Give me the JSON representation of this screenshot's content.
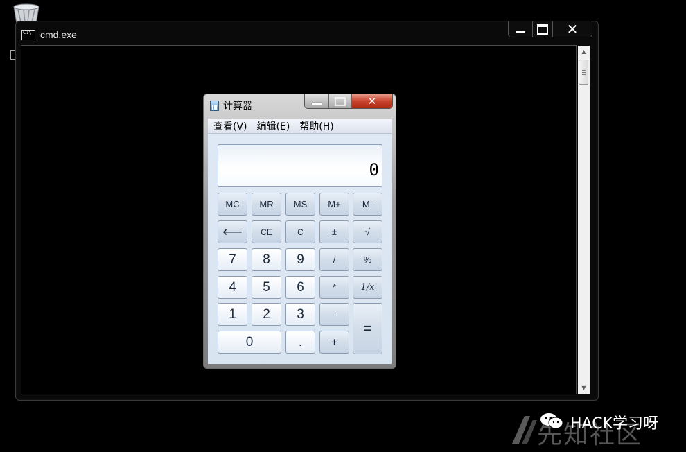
{
  "cmd": {
    "title": "cmd.exe",
    "icon": "console-icon",
    "controls": {
      "minimize": "minimize-icon",
      "maximize": "maximize-icon",
      "close": "close-icon"
    }
  },
  "calculator": {
    "title": "计算器",
    "menu": [
      "查看(V)",
      "编辑(E)",
      "帮助(H)"
    ],
    "display_value": "0",
    "keys": {
      "mc": "MC",
      "mr": "MR",
      "ms": "MS",
      "mplus": "M+",
      "mminus": "M-",
      "backspace": "⟵",
      "ce": "CE",
      "c": "C",
      "plusminus": "±",
      "sqrt": "√",
      "n7": "7",
      "n8": "8",
      "n9": "9",
      "divide": "/",
      "percent": "%",
      "n4": "4",
      "n5": "5",
      "n6": "6",
      "multiply": "*",
      "reciprocal": "1/x",
      "n1": "1",
      "n2": "2",
      "n3": "3",
      "minus": "-",
      "equals": "=",
      "n0": "0",
      "dot": ".",
      "plus": "+"
    }
  },
  "watermark": {
    "text": "HACK学习呀",
    "background_text": "先知社区"
  },
  "colors": {
    "desktop": "#000000",
    "close_red": "#c8432c",
    "calc_body": "#dfe9f5"
  }
}
